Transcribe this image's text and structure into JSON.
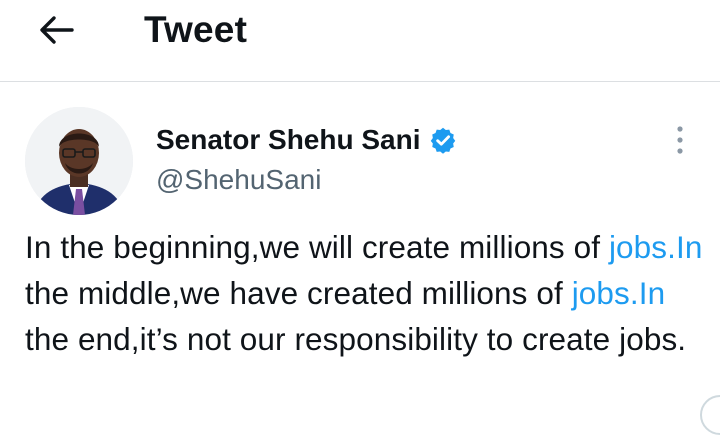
{
  "header": {
    "title": "Tweet",
    "back_icon": "arrow-left-icon"
  },
  "author": {
    "name": "Senator Shehu Sani",
    "handle": "@ShehuSani",
    "verified": true,
    "verified_color": "#1d9bf0",
    "avatar": "profile-photo"
  },
  "menu": {
    "icon": "more-vertical-icon"
  },
  "tweet": {
    "segments": [
      {
        "text": "In the beginning,we will create millions of ",
        "link": false
      },
      {
        "text": "jobs.In",
        "link": true
      },
      {
        "text": " the middle,we have created millions of ",
        "link": false
      },
      {
        "text": "jobs.In",
        "link": true
      },
      {
        "text": " the end,it’s not our responsibility to create jobs.",
        "link": false
      }
    ]
  },
  "colors": {
    "text": "#0f1419",
    "secondary": "#536471",
    "link": "#1d9bf0",
    "divider": "#dcdfe2"
  }
}
